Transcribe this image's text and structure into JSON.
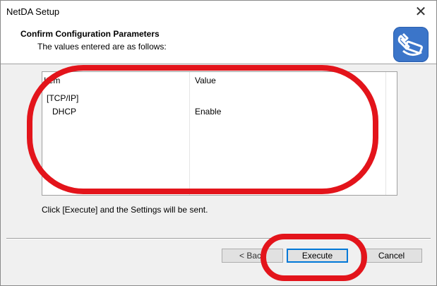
{
  "window": {
    "title": "NetDA Setup"
  },
  "header": {
    "title": "Confirm Configuration Parameters",
    "subtitle": "The values entered are as follows:",
    "icon": "network-settings-icon"
  },
  "list": {
    "columns": [
      "Item",
      "Value"
    ],
    "rows": [
      {
        "item": "[TCP/IP]",
        "value": ""
      },
      {
        "item": "DHCP",
        "value": "Enable"
      }
    ]
  },
  "status_text": "Click [Execute] and the Settings will be sent.",
  "buttons": {
    "back": "< Back",
    "execute": "Execute",
    "cancel": "Cancel"
  },
  "colors": {
    "annotation": "#e3141b",
    "icon_bg": "#3b75c9"
  }
}
